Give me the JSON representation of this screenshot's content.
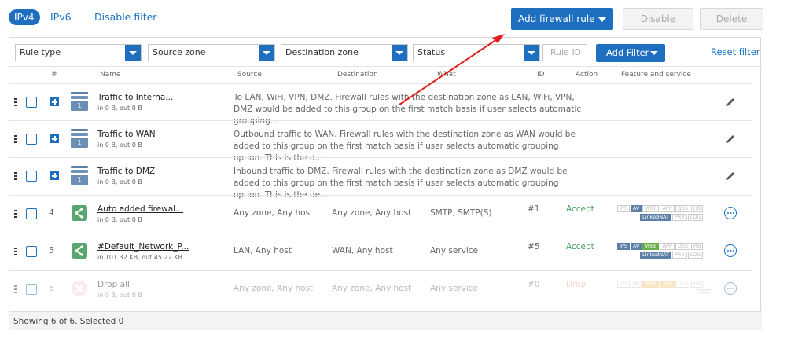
{
  "tabs": {
    "ipv4": "IPv4",
    "ipv6": "IPv6",
    "disable_filter": "Disable filter"
  },
  "toolbar": {
    "add_rule": "Add firewall rule",
    "disable": "Disable",
    "delete": "Delete"
  },
  "filters": {
    "rule_type": "Rule type",
    "source_zone": "Source zone",
    "destination_zone": "Destination zone",
    "status": "Status",
    "rule_id_placeholder": "Rule ID",
    "add_filter": "Add Filter",
    "reset_filter": "Reset filter"
  },
  "columns": {
    "num": "#",
    "name": "Name",
    "source": "Source",
    "destination": "Destination",
    "what": "What",
    "id": "ID",
    "action": "Action",
    "feature": "Feature and service"
  },
  "groups": [
    {
      "name": "Traffic to Interna...",
      "sub": "in 0 B, out 0 B",
      "count": "1",
      "desc": "To LAN, WiFi, VPN, DMZ. Firewall rules with the destination zone as LAN, WiFi, VPN, DMZ would be added to this group on the first match basis if user selects automatic grouping..."
    },
    {
      "name": "Traffic to WAN",
      "sub": "in 0 B, out 0 B",
      "count": "1",
      "desc": "Outbound traffic to WAN. Firewall rules with the destination zone as WAN would be added to this group on the first match basis if user selects automatic grouping option. This is the d..."
    },
    {
      "name": "Traffic to DMZ",
      "sub": "in 0 B, out 0 B",
      "count": "1",
      "desc": "Inbound traffic to DMZ. Firewall rules with the destination zone as DMZ would be added to this group on the first match basis if user selects automatic grouping option. This is the de..."
    }
  ],
  "rules": [
    {
      "num": "4",
      "name": "Auto added firewal...",
      "sub": "in 0 B, out 0 B",
      "source": "Any zone, Any host",
      "destination": "Any zone, Any host",
      "what": "SMTP, SMTP(S)",
      "id": "#1",
      "action": "Accept"
    },
    {
      "num": "5",
      "name": "#Default_Network_P...",
      "sub": "in 101.32 KB, out 45.22 KB",
      "source": "LAN, Any host",
      "destination": "WAN, Any host",
      "what": "Any service",
      "id": "#5",
      "action": "Accept"
    },
    {
      "num": "6",
      "name": "Drop all",
      "sub": "in 0 B, out 0 B",
      "source": "Any zone, Any host",
      "destination": "Any zone, Any host",
      "what": "Any service",
      "id": "#0",
      "action": "Drop"
    }
  ],
  "badges": {
    "ips": "IPS",
    "av": "AV",
    "web": "WEB",
    "app": "APP",
    "qos": "QoS",
    "hb": "HB",
    "linkednat": "LinkedNAT",
    "prx": "PRX",
    "log": "LOG"
  },
  "footer": "Showing 6 of 6. Selected 0",
  "colors": {
    "accent": "#1f6fc0",
    "accept": "#46a05e",
    "drop": "#ee9999",
    "annotation_arrow": "#e02020"
  }
}
